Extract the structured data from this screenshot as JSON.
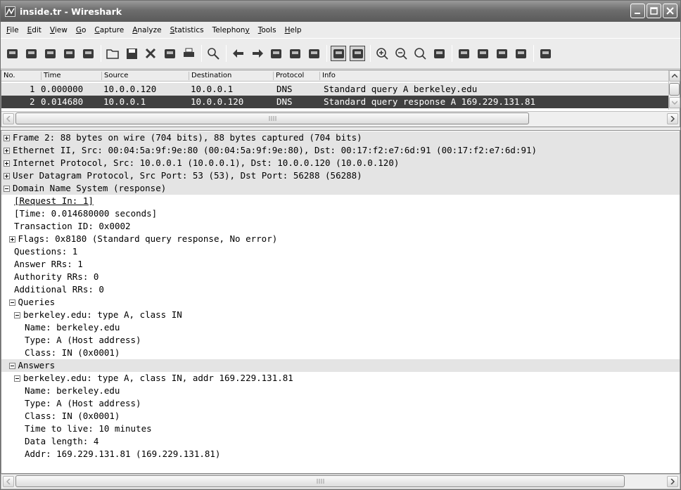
{
  "window": {
    "title": "inside.tr - Wireshark"
  },
  "menu": [
    {
      "pre": "",
      "u": "F",
      "post": "ile"
    },
    {
      "pre": "",
      "u": "E",
      "post": "dit"
    },
    {
      "pre": "",
      "u": "V",
      "post": "iew"
    },
    {
      "pre": "",
      "u": "G",
      "post": "o"
    },
    {
      "pre": "",
      "u": "C",
      "post": "apture"
    },
    {
      "pre": "",
      "u": "A",
      "post": "nalyze"
    },
    {
      "pre": "",
      "u": "S",
      "post": "tatistics"
    },
    {
      "pre": "Telephon",
      "u": "y",
      "post": ""
    },
    {
      "pre": "",
      "u": "T",
      "post": "ools"
    },
    {
      "pre": "",
      "u": "H",
      "post": "elp"
    }
  ],
  "toolbar_icons": [
    "interface-list-icon",
    "capture-options-icon",
    "start-capture-icon",
    "stop-capture-icon",
    "restart-capture-icon",
    "open-file-icon",
    "save-file-icon",
    "close-file-icon",
    "reload-icon",
    "print-icon",
    "find-icon",
    "go-back-icon",
    "go-forward-icon",
    "go-to-packet-icon",
    "go-first-icon",
    "go-last-icon",
    "colorize-icon",
    "autoscroll-icon",
    "zoom-in-icon",
    "zoom-out-icon",
    "zoom-normal-icon",
    "resize-columns-icon",
    "capture-filters-icon",
    "display-filters-icon",
    "coloring-rules-icon",
    "preferences-icon",
    "help-icon"
  ],
  "packet_list": {
    "columns": [
      "No.",
      "Time",
      "Source",
      "Destination",
      "Protocol",
      "Info"
    ],
    "rows": [
      {
        "no": "1",
        "time": "0.000000",
        "source": "10.0.0.120",
        "destination": "10.0.0.1",
        "protocol": "DNS",
        "info": "Standard query A berkeley.edu"
      },
      {
        "no": "2",
        "time": "0.014680",
        "source": "10.0.0.1",
        "destination": "10.0.0.120",
        "protocol": "DNS",
        "info": "Standard query response A 169.229.131.81"
      }
    ]
  },
  "details": [
    {
      "expander": "plus",
      "indent": 0,
      "text": "Frame 2: 88 bytes on wire (704 bits), 88 bytes captured (704 bits)",
      "hl": true
    },
    {
      "expander": "plus",
      "indent": 0,
      "text": "Ethernet II, Src: 00:04:5a:9f:9e:80 (00:04:5a:9f:9e:80), Dst: 00:17:f2:e7:6d:91 (00:17:f2:e7:6d:91)",
      "hl": true
    },
    {
      "expander": "plus",
      "indent": 0,
      "text": "Internet Protocol, Src: 10.0.0.1 (10.0.0.1), Dst: 10.0.0.120 (10.0.0.120)",
      "hl": true
    },
    {
      "expander": "plus",
      "indent": 0,
      "text": "User Datagram Protocol, Src Port: 53 (53), Dst Port: 56288 (56288)",
      "hl": true
    },
    {
      "expander": "minus",
      "indent": 0,
      "text": "Domain Name System (response)",
      "hl": true
    },
    {
      "expander": "",
      "indent": 2,
      "text": "[Request In: 1]",
      "link": true
    },
    {
      "expander": "",
      "indent": 2,
      "text": "[Time: 0.014680000 seconds]"
    },
    {
      "expander": "",
      "indent": 2,
      "text": "Transaction ID: 0x0002"
    },
    {
      "expander": "plus",
      "indent": 1,
      "text": "Flags: 0x8180 (Standard query response, No error)"
    },
    {
      "expander": "",
      "indent": 2,
      "text": "Questions: 1"
    },
    {
      "expander": "",
      "indent": 2,
      "text": "Answer RRs: 1"
    },
    {
      "expander": "",
      "indent": 2,
      "text": "Authority RRs: 0"
    },
    {
      "expander": "",
      "indent": 2,
      "text": "Additional RRs: 0"
    },
    {
      "expander": "minus",
      "indent": 1,
      "text": "Queries"
    },
    {
      "expander": "minus",
      "indent": 2,
      "text": "berkeley.edu: type A, class IN"
    },
    {
      "expander": "",
      "indent": 4,
      "text": "Name: berkeley.edu"
    },
    {
      "expander": "",
      "indent": 4,
      "text": "Type: A (Host address)"
    },
    {
      "expander": "",
      "indent": 4,
      "text": "Class: IN (0x0001)"
    },
    {
      "expander": "minus",
      "indent": 1,
      "text": "Answers",
      "hl": true
    },
    {
      "expander": "minus",
      "indent": 2,
      "text": "berkeley.edu: type A, class IN, addr 169.229.131.81"
    },
    {
      "expander": "",
      "indent": 4,
      "text": "Name: berkeley.edu"
    },
    {
      "expander": "",
      "indent": 4,
      "text": "Type: A (Host address)"
    },
    {
      "expander": "",
      "indent": 4,
      "text": "Class: IN (0x0001)"
    },
    {
      "expander": "",
      "indent": 4,
      "text": "Time to live: 10 minutes"
    },
    {
      "expander": "",
      "indent": 4,
      "text": "Data length: 4"
    },
    {
      "expander": "",
      "indent": 4,
      "text": "Addr: 169.229.131.81 (169.229.131.81)"
    }
  ]
}
